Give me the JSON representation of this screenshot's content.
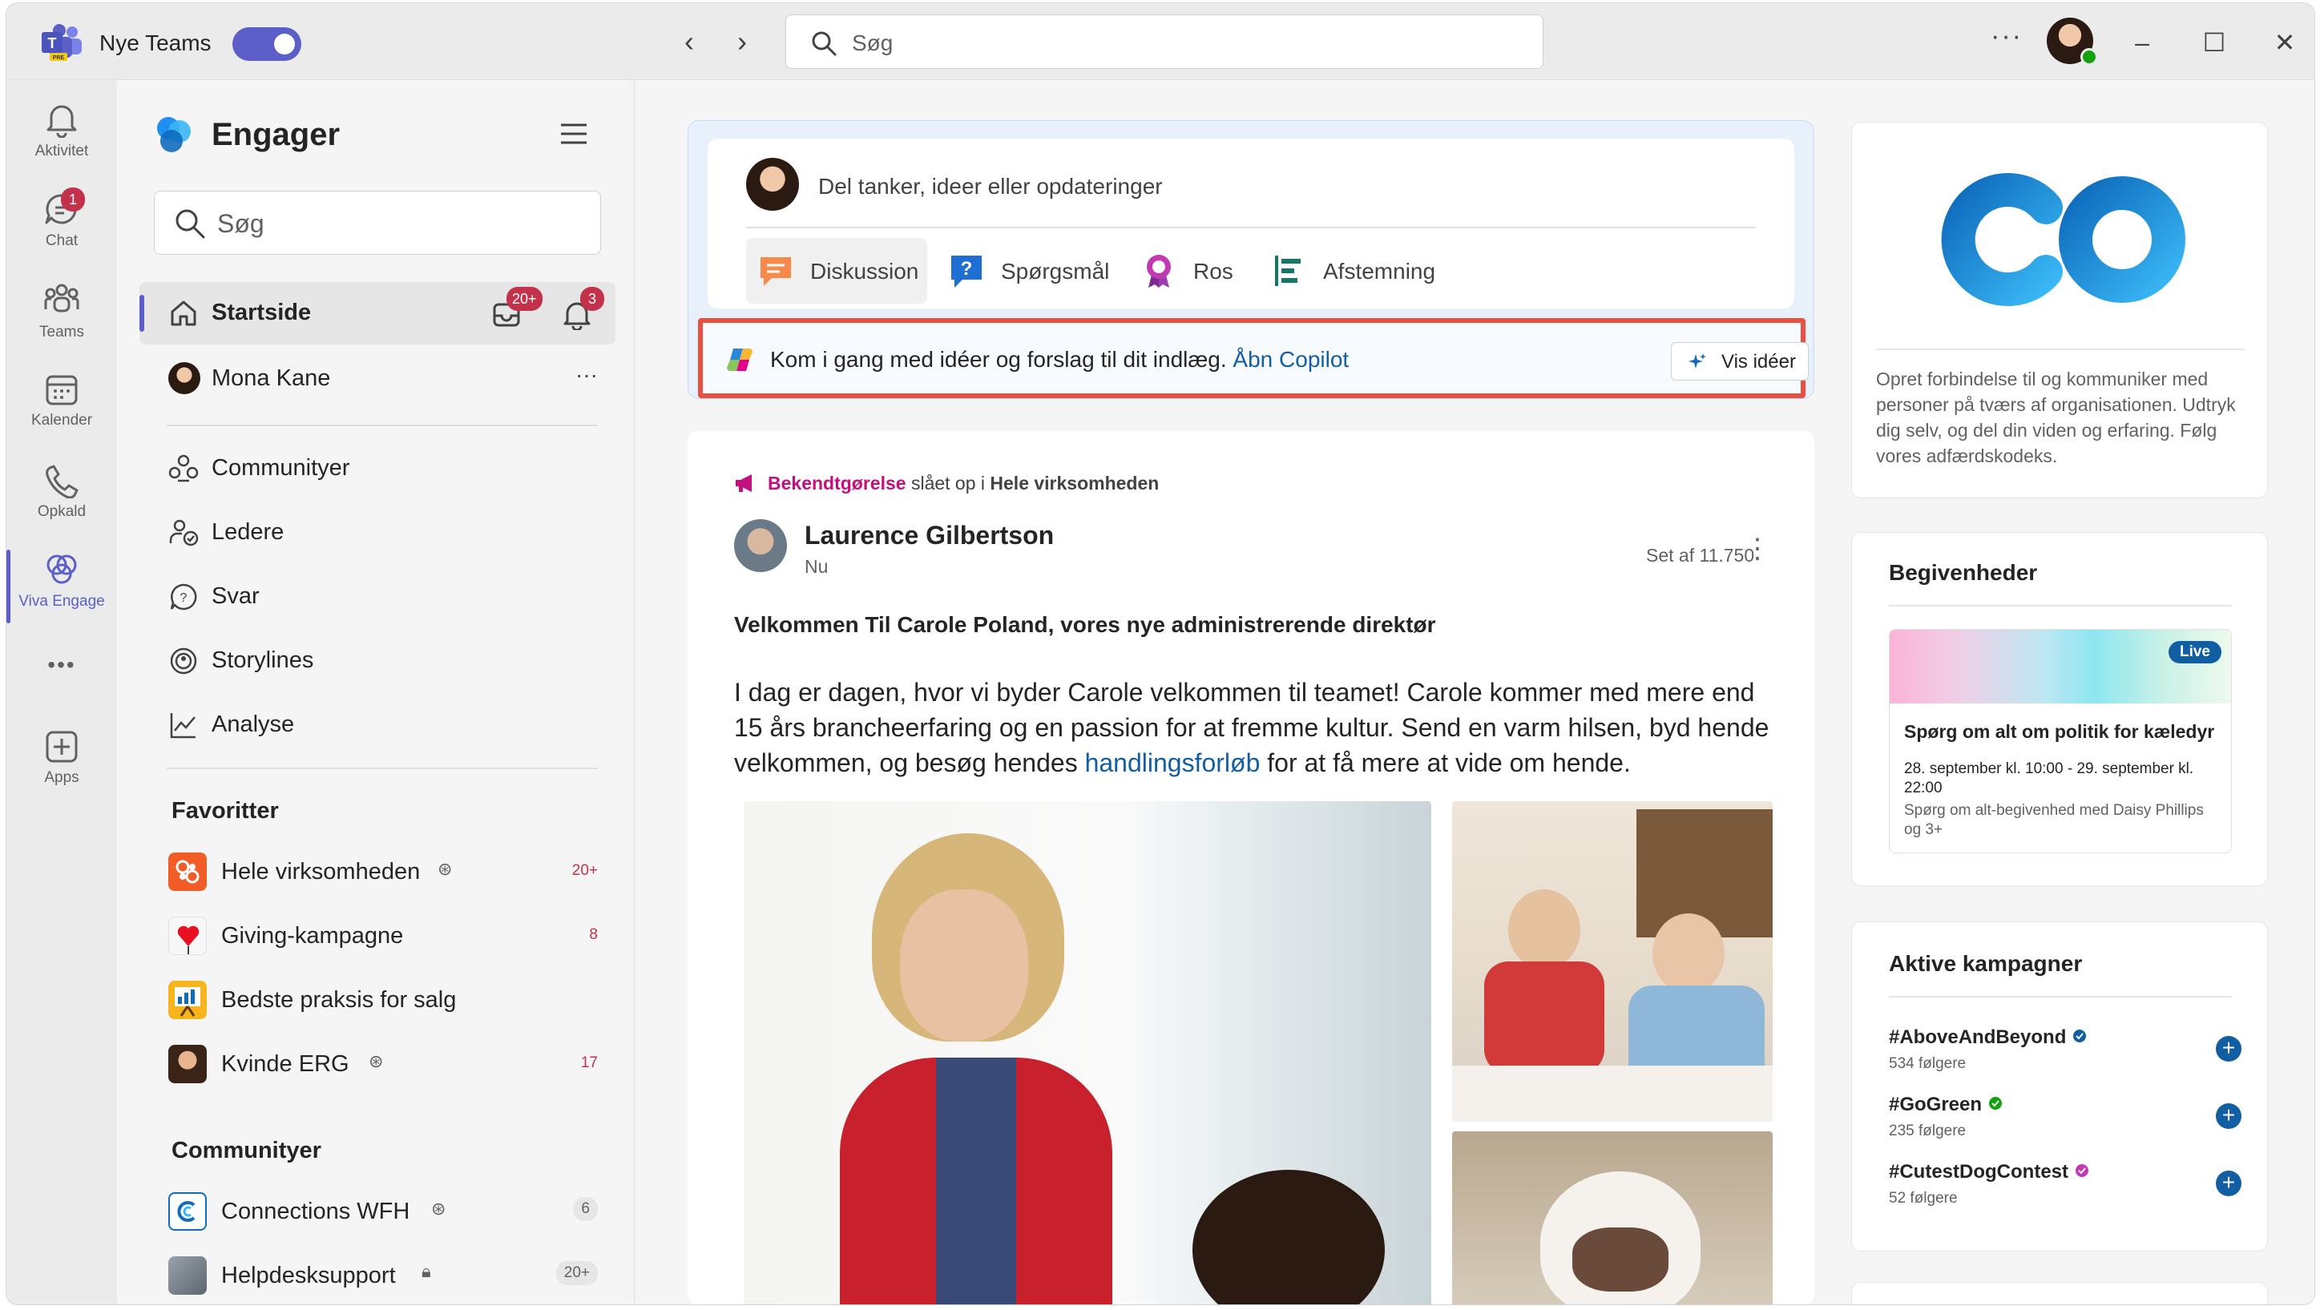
{
  "titlebar": {
    "app_name": "Nye Teams",
    "search_placeholder": "Søg",
    "more": "···"
  },
  "rail": {
    "items": [
      {
        "label": "Aktivitet",
        "icon": "bell-icon"
      },
      {
        "label": "Chat",
        "icon": "chat-icon",
        "badge": "1"
      },
      {
        "label": "Teams",
        "icon": "teams-icon"
      },
      {
        "label": "Kalender",
        "icon": "calendar-icon"
      },
      {
        "label": "Opkald",
        "icon": "phone-icon"
      },
      {
        "label": "Viva Engage",
        "icon": "viva-engage-icon",
        "active": true
      },
      {
        "label": "Apps",
        "icon": "apps-icon"
      }
    ],
    "more": "•••"
  },
  "left": {
    "title": "Engager",
    "search_placeholder": "Søg",
    "home": {
      "label": "Startside",
      "inbox_badge": "20+",
      "notif_badge": "3"
    },
    "user": {
      "label": "Mona Kane",
      "more": "···"
    },
    "nav": [
      {
        "label": "Communityer",
        "icon": "communities-icon"
      },
      {
        "label": "Ledere",
        "icon": "leaders-icon"
      },
      {
        "label": "Svar",
        "icon": "answers-icon"
      },
      {
        "label": "Storylines",
        "icon": "storylines-icon"
      },
      {
        "label": "Analyse",
        "icon": "analytics-icon"
      }
    ],
    "favorites_heading": "Favoritter",
    "favorites": [
      {
        "label": "Hele virksomheden",
        "count": "20+"
      },
      {
        "label": "Giving-kampagne",
        "count": "8"
      },
      {
        "label": "Bedste praksis for salg",
        "count": ""
      },
      {
        "label": "Kvinde ERG",
        "count": "17"
      }
    ],
    "communities_heading": "Communityer",
    "communities": [
      {
        "label": "Connections WFH",
        "count": "6"
      },
      {
        "label": "Helpdesksupport",
        "count": "20+"
      }
    ]
  },
  "composer": {
    "prompt": "Del tanker, ideer eller opdateringer",
    "types": [
      {
        "label": "Diskussion",
        "icon": "discussion-icon"
      },
      {
        "label": "Spørgsmål",
        "icon": "question-icon"
      },
      {
        "label": "Ros",
        "icon": "praise-icon"
      },
      {
        "label": "Afstemning",
        "icon": "poll-icon"
      }
    ],
    "copilot_text": "Kom i gang med idéer og forslag til dit indlæg.",
    "copilot_link": "Åbn Copilot",
    "copilot_button": "Vis idéer"
  },
  "post": {
    "announcement_type": "Bekendtgørelse",
    "posted_in_text": "slået op i",
    "posted_in": "Hele virksomheden",
    "author": "Laurence Gilbertson",
    "time": "Nu",
    "seen": "Set af 11.750",
    "title": "Velkommen Til Carole Poland, vores nye administrerende direktør",
    "body_before": "I dag er dagen, hvor vi byder Carole velkommen til teamet! Carole kommer med mere end 15 års brancheerfaring og en passion for at fremme kultur. Send en varm hilsen, byd hende velkommen, og besøg hendes ",
    "body_link": "handlingsforløb",
    "body_after": " for at få mere at vide om hende."
  },
  "about_card": {
    "logo_text": "CO",
    "description": "Opret forbindelse til og kommuniker med personer på tværs af organisationen. Udtryk dig selv, og del din viden og erfaring. Følg vores adfærdskodeks."
  },
  "events_card": {
    "heading": "Begivenheder",
    "live": "Live",
    "title": "Spørg om alt om politik for kæledyr",
    "date": "28. september kl. 10:00 - 29. september kl. 22:00",
    "sub": "Spørg om alt-begivenhed med Daisy Phillips og 3+"
  },
  "campaigns_card": {
    "heading": "Aktive kampagner",
    "items": [
      {
        "tag": "#AboveAndBeyond",
        "followers": "534 følgere",
        "verified_color": "#115ea3"
      },
      {
        "tag": "#GoGreen",
        "followers": "235 følgere",
        "verified_color": "#13a10e"
      },
      {
        "tag": "#CutestDogContest",
        "followers": "52 følgere",
        "verified_color": "#c239b3"
      }
    ]
  },
  "colors": {
    "accent": "#5b5fc7",
    "link": "#115ea3",
    "badge": "#c4314b",
    "highlight_border": "#e8503f"
  }
}
